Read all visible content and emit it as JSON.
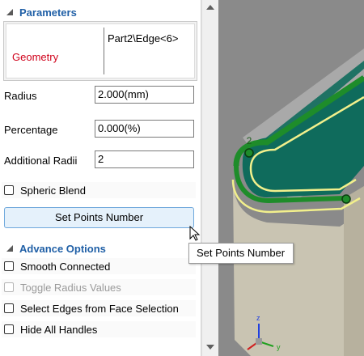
{
  "parameters": {
    "title": "Parameters",
    "geometry_label": "Geometry",
    "geometry_value": "Part2\\Edge<6>",
    "radius_label": "Radius",
    "radius_value": "2.000(mm)",
    "percentage_label": "Percentage",
    "percentage_value": "0.000(%)",
    "additional_radii_label": "Additional Radii",
    "additional_radii_value": "2",
    "spheric_blend_label": "Spheric Blend",
    "spheric_blend_checked": false,
    "set_points_button": "Set Points Number"
  },
  "advance_options": {
    "title": "Advance Options",
    "items": [
      {
        "label": "Smooth Connected",
        "checked": false,
        "enabled": true
      },
      {
        "label": "Toggle Radius Values",
        "checked": false,
        "enabled": false
      },
      {
        "label": "Select Edges from Face Selection",
        "checked": false,
        "enabled": true
      },
      {
        "label": "Hide All Handles",
        "checked": false,
        "enabled": true
      }
    ]
  },
  "tooltip": "Set Points Number",
  "viewport": {
    "handle_label": "2",
    "axis_z": "z",
    "axis_y": "y",
    "colors": {
      "background": "#8a8a8a",
      "face": "#0f6b5c",
      "edge_highlight": "#f2f08c",
      "edge_green": "#1e8c2a",
      "body": "#c9c4b2",
      "shaft": "#a8a8a8"
    }
  }
}
